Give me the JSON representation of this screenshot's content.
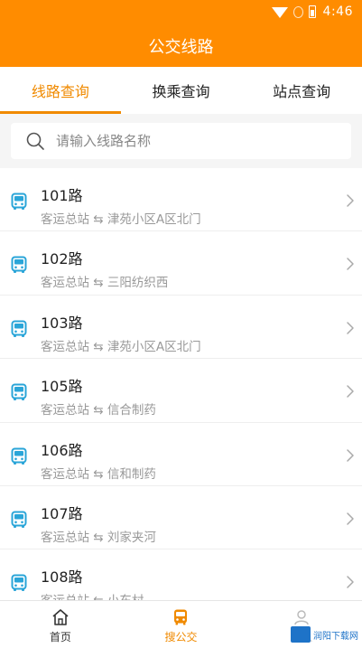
{
  "status_bar": {
    "time": "4:46"
  },
  "header": {
    "title": "公交线路"
  },
  "tabs": [
    {
      "label": "线路查询",
      "active": true
    },
    {
      "label": "换乘查询",
      "active": false
    },
    {
      "label": "站点查询",
      "active": false
    }
  ],
  "search": {
    "placeholder": "请输入线路名称",
    "icon": "search-icon"
  },
  "routes": [
    {
      "name": "101路",
      "from": "客运总站",
      "to": "津苑小区A区北门"
    },
    {
      "name": "102路",
      "from": "客运总站",
      "to": "三阳纺织西"
    },
    {
      "name": "103路",
      "from": "客运总站",
      "to": "津苑小区A区北门"
    },
    {
      "name": "105路",
      "from": "客运总站",
      "to": "信合制药"
    },
    {
      "name": "106路",
      "from": "客运总站",
      "to": "信和制药"
    },
    {
      "name": "107路",
      "from": "客运总站",
      "to": "刘家夹河"
    },
    {
      "name": "108路",
      "from": "客运总站",
      "to": "小东村"
    }
  ],
  "route_separator": "⇆",
  "bottom_nav": [
    {
      "label": "首页",
      "icon": "home-icon",
      "active": false
    },
    {
      "label": "搜公交",
      "icon": "bus-search-icon",
      "active": true
    },
    {
      "label": "个人",
      "icon": "person-icon",
      "active": false
    }
  ],
  "watermark": {
    "text": "润阳下载网"
  },
  "colors": {
    "accent": "#ff8c00",
    "bus_icon": "#2aa5d8",
    "tab_active": "#f08a00"
  }
}
